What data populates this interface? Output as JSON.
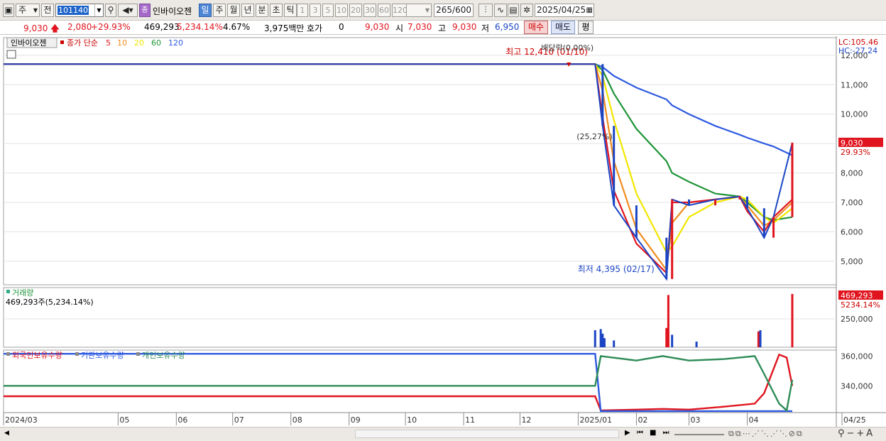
{
  "toolbar": {
    "period_unit": "주",
    "prev_label": "전",
    "stock_code": "101140",
    "stock_name": "인바이오젠",
    "stock_badge": "종",
    "periods": [
      "일",
      "주",
      "월",
      "년",
      "분",
      "초",
      "틱"
    ],
    "active_period": "일",
    "minute_options": [
      "1",
      "3",
      "5",
      "10",
      "20",
      "30",
      "60",
      "120"
    ],
    "bar_count": "265",
    "bar_total": "/600",
    "date": "2025/04/25"
  },
  "quote": {
    "price": "9,030",
    "change": "2,080",
    "change_pct": "+29.93%",
    "volume": "469,293",
    "volume_pct": "5,234.14%",
    "turnover": "4.67%",
    "amount": "3,975백만",
    "hoga_label": "호가",
    "hoga_value": "0",
    "current_price": "9,030",
    "open_label": "시",
    "open": "7,030",
    "high_label": "고",
    "high": "9,030",
    "low_label": "저",
    "low": "6,950",
    "buy_label": "매수",
    "sell_label": "매도",
    "avg_label": "평"
  },
  "price_panel": {
    "stock_name": "인바이오젠",
    "indicator_label": "종가 단순",
    "ma_periods": [
      "5",
      "10",
      "20",
      "60",
      "120"
    ],
    "ma_colors": [
      "#e0141e",
      "#f08c1e",
      "#f2e600",
      "#1e9437",
      "#2e5ae0"
    ],
    "high_annotation": "최고 12,410 (01/10)",
    "dividend_annotation": "배당락(0.00%)",
    "drop_annotation": "(25,27%)",
    "low_annotation": "최저 4,395 (02/17)",
    "lc_label": "LC:105.46",
    "hc_label": "HC:-27.24",
    "price_tag": "9,030",
    "price_tag_pct": "29.93%",
    "y_ticks": [
      "12,000",
      "11,000",
      "10,000",
      "9,000",
      "8,000",
      "7,000",
      "6,000",
      "5,000"
    ]
  },
  "volume_panel": {
    "title": "거래량",
    "value_label": "469,293주(5,234.14%)",
    "tag_value": "469,293",
    "tag_pct": "5234.14%",
    "y_tick": "250,000"
  },
  "holdings_panel": {
    "series_labels": [
      "외국인보유수량",
      "기관보유수량",
      "개인보유수량"
    ],
    "series_colors": [
      "#e0141e",
      "#2e5ae0",
      "#2e8b57"
    ],
    "y_ticks": [
      "360,000",
      "340,000"
    ]
  },
  "x_axis_labels": [
    "2024/03",
    "05",
    "06",
    "07",
    "08",
    "09",
    "10",
    "11",
    "12",
    "2025/01",
    "02",
    "03",
    "04",
    "04/25"
  ],
  "chart_data": [
    {
      "type": "candlestick",
      "title": "인바이오젠",
      "ylim": [
        4200,
        12600
      ],
      "x": [
        "2024/03",
        "2025/01/10",
        "2025/01/14",
        "2025/01/20",
        "2025/02/01",
        "2025/02/17",
        "2025/02/20",
        "2025/03/01",
        "2025/03/15",
        "2025/03/28",
        "2025/04/01",
        "2025/04/10",
        "2025/04/15",
        "2025/04/25"
      ],
      "close": [
        11700,
        11700,
        9600,
        6900,
        5800,
        4395,
        7100,
        6900,
        7100,
        7200,
        6800,
        5800,
        6500,
        9030
      ],
      "series": [
        {
          "name": "5",
          "values": [
            11700,
            11700,
            9900,
            7400,
            5600,
            4600,
            7000,
            7000,
            7100,
            7200,
            6700,
            6000,
            6500,
            7100
          ]
        },
        {
          "name": "10",
          "values": [
            11700,
            11700,
            10800,
            8400,
            6100,
            4700,
            6300,
            7000,
            7100,
            7200,
            6900,
            6200,
            6400,
            7000
          ]
        },
        {
          "name": "20",
          "values": [
            11700,
            11700,
            11300,
            9800,
            7300,
            5300,
            5500,
            6500,
            7000,
            7200,
            7100,
            6500,
            6300,
            6800
          ]
        },
        {
          "name": "60",
          "values": [
            11700,
            11700,
            11500,
            10700,
            9500,
            8400,
            8000,
            7700,
            7300,
            7200,
            7000,
            6500,
            6400,
            6500
          ]
        },
        {
          "name": "120",
          "values": [
            11700,
            11700,
            11600,
            11300,
            10900,
            10500,
            10300,
            10000,
            9600,
            9300,
            9200,
            9000,
            8900,
            8600
          ]
        }
      ]
    },
    {
      "type": "bar",
      "title": "거래량",
      "categories": [
        "2025/01/10",
        "2025/01/13",
        "2025/01/14",
        "2025/01/15",
        "2025/01/20",
        "2025/02/17",
        "2025/02/18",
        "2025/02/20",
        "2025/03/05",
        "2025/04/07",
        "2025/04/08",
        "2025/04/25"
      ],
      "values": [
        150000,
        160000,
        120000,
        80000,
        60000,
        170000,
        460000,
        110000,
        50000,
        140000,
        150000,
        469293
      ],
      "ylim": [
        0,
        500000
      ]
    },
    {
      "type": "line",
      "title": "",
      "ylim": [
        322000,
        364000
      ],
      "x": [
        "2024/03",
        "2025/01/10",
        "2025/01/13",
        "2025/02/01",
        "2025/02/15",
        "2025/03/01",
        "2025/03/20",
        "2025/04/05",
        "2025/04/10",
        "2025/04/18",
        "2025/04/22",
        "2025/04/25"
      ],
      "series": [
        {
          "name": "외국인보유수량",
          "values": [
            333000,
            333000,
            323500,
            324000,
            324500,
            324000,
            326000,
            328000,
            335000,
            361000,
            359000,
            340000
          ]
        },
        {
          "name": "기관보유수량",
          "values": [
            361500,
            361500,
            323000,
            323000,
            323000,
            323000,
            323000,
            323000,
            323000,
            323000,
            323000,
            323000
          ]
        },
        {
          "name": "개인보유수량",
          "values": [
            340000,
            340000,
            360000,
            357000,
            360000,
            357000,
            358000,
            360000,
            348000,
            328000,
            323500,
            344000
          ]
        }
      ]
    }
  ]
}
